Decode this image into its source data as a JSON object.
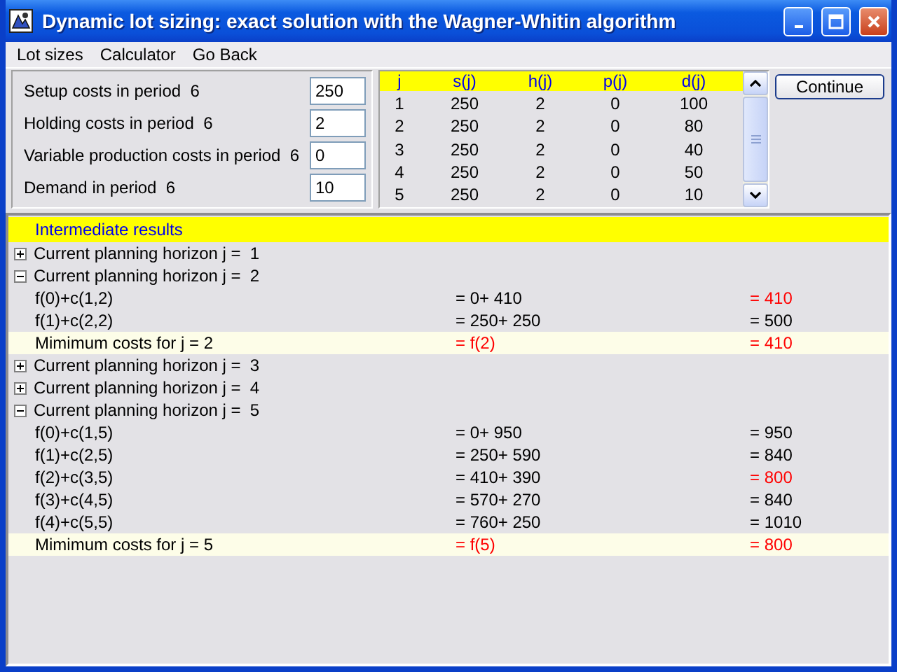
{
  "window": {
    "title": "Dynamic lot sizing: exact solution with the Wagner-Whitin algorithm"
  },
  "menu": [
    "Lot sizes",
    "Calculator",
    "Go Back"
  ],
  "inputs": [
    {
      "label": "Setup costs in period  6",
      "value": "250"
    },
    {
      "label": "Holding costs in period  6",
      "value": "2"
    },
    {
      "label": "Variable production costs in period  6",
      "value": "0"
    },
    {
      "label": "Demand in period  6",
      "value": "10"
    }
  ],
  "grid": {
    "columns": [
      "j",
      "s(j)",
      "h(j)",
      "p(j)",
      "d(j)"
    ],
    "rows": [
      [
        "1",
        "250",
        "2",
        "0",
        "100"
      ],
      [
        "2",
        "250",
        "2",
        "0",
        "80"
      ],
      [
        "3",
        "250",
        "2",
        "0",
        "40"
      ],
      [
        "4",
        "250",
        "2",
        "0",
        "50"
      ],
      [
        "5",
        "250",
        "2",
        "0",
        "10"
      ]
    ]
  },
  "continue_button": "Continue",
  "results": {
    "title": "Intermediate results",
    "rows": [
      {
        "kind": "group",
        "text": "Current planning horizon j =  1",
        "expanded": false
      },
      {
        "kind": "group",
        "text": "Current planning horizon j =  2",
        "expanded": true
      },
      {
        "kind": "line",
        "text": "f(0)+c(1,2)",
        "expr": "= 0+ 410",
        "total": "= 410",
        "minimal": true
      },
      {
        "kind": "line",
        "text": "f(1)+c(2,2)",
        "expr": "= 250+ 250",
        "total": "= 500",
        "minimal": false
      },
      {
        "kind": "summary",
        "text": "Mimimum costs for j = 2",
        "expr": "= f(2)",
        "total": "= 410"
      },
      {
        "kind": "group",
        "text": "Current planning horizon j =  3",
        "expanded": false
      },
      {
        "kind": "group",
        "text": "Current planning horizon j =  4",
        "expanded": false
      },
      {
        "kind": "group",
        "text": "Current planning horizon j =  5",
        "expanded": true
      },
      {
        "kind": "line",
        "text": "f(0)+c(1,5)",
        "expr": "= 0+ 950",
        "total": "= 950",
        "minimal": false
      },
      {
        "kind": "line",
        "text": "f(1)+c(2,5)",
        "expr": "= 250+ 590",
        "total": "= 840",
        "minimal": false
      },
      {
        "kind": "line",
        "text": "f(2)+c(3,5)",
        "expr": "= 410+ 390",
        "total": "= 800",
        "minimal": true
      },
      {
        "kind": "line",
        "text": "f(3)+c(4,5)",
        "expr": "= 570+ 270",
        "total": "= 840",
        "minimal": false
      },
      {
        "kind": "line",
        "text": "f(4)+c(5,5)",
        "expr": "= 760+ 250",
        "total": "= 1010",
        "minimal": false
      },
      {
        "kind": "summary",
        "text": "Mimimum costs for j = 5",
        "expr": "= f(5)",
        "total": "= 800"
      }
    ]
  }
}
